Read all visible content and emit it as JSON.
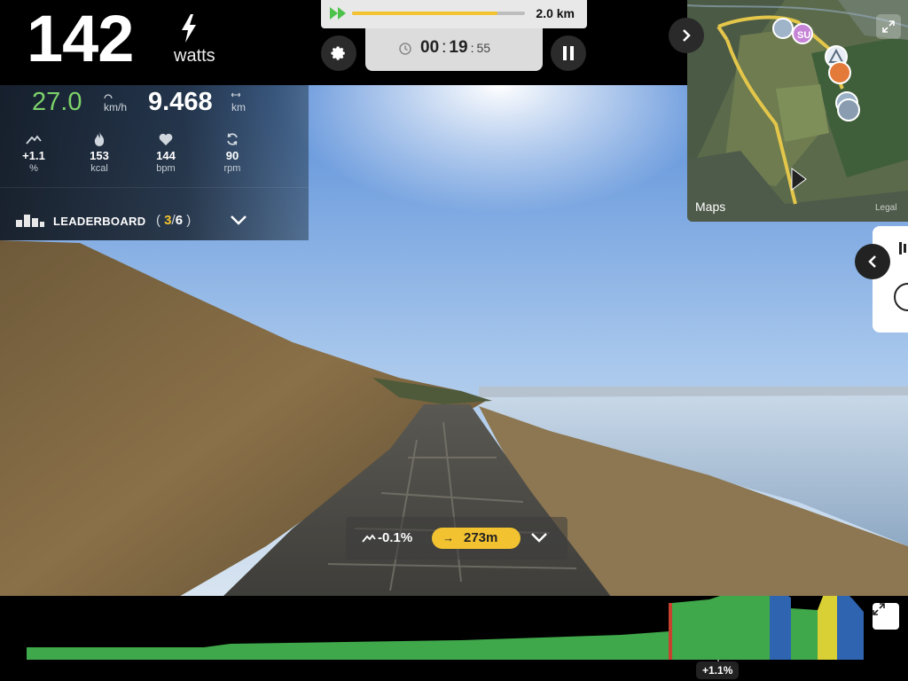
{
  "power": {
    "value": "142",
    "unit": "watts"
  },
  "progress": {
    "total_distance": "2.0 km",
    "completed_fraction": 0.84
  },
  "timer": {
    "hours": "00",
    "minutes": "19",
    "seconds": "55"
  },
  "stats": {
    "speed": {
      "value": "27.0",
      "unit": "km/h"
    },
    "distance": {
      "value": "9.468",
      "unit": "km"
    },
    "metrics": [
      {
        "icon": "grade-icon",
        "value": "+1.1",
        "unit": "%"
      },
      {
        "icon": "flame-icon",
        "value": "153",
        "unit": "kcal"
      },
      {
        "icon": "heart-icon",
        "value": "144",
        "unit": "bpm"
      },
      {
        "icon": "cadence-icon",
        "value": "90",
        "unit": "rpm"
      }
    ]
  },
  "leaderboard": {
    "label": "LEADERBOARD",
    "open": "(",
    "position": "3",
    "slash": "/",
    "total": "6",
    "close": ")"
  },
  "map": {
    "maps_label": "Maps",
    "legal_label": "Legal",
    "avatar_initials": "SU"
  },
  "grade_bar": {
    "grade": "-0.1%",
    "segment_distance": "273m"
  },
  "profile": {
    "current_grade": "+1.1%"
  },
  "colors": {
    "accent_yellow": "#f2c230",
    "speed_green": "#7cd36a",
    "profile_green": "#3fa84a",
    "profile_blue": "#2e64b0",
    "profile_yellow": "#d8d034"
  }
}
